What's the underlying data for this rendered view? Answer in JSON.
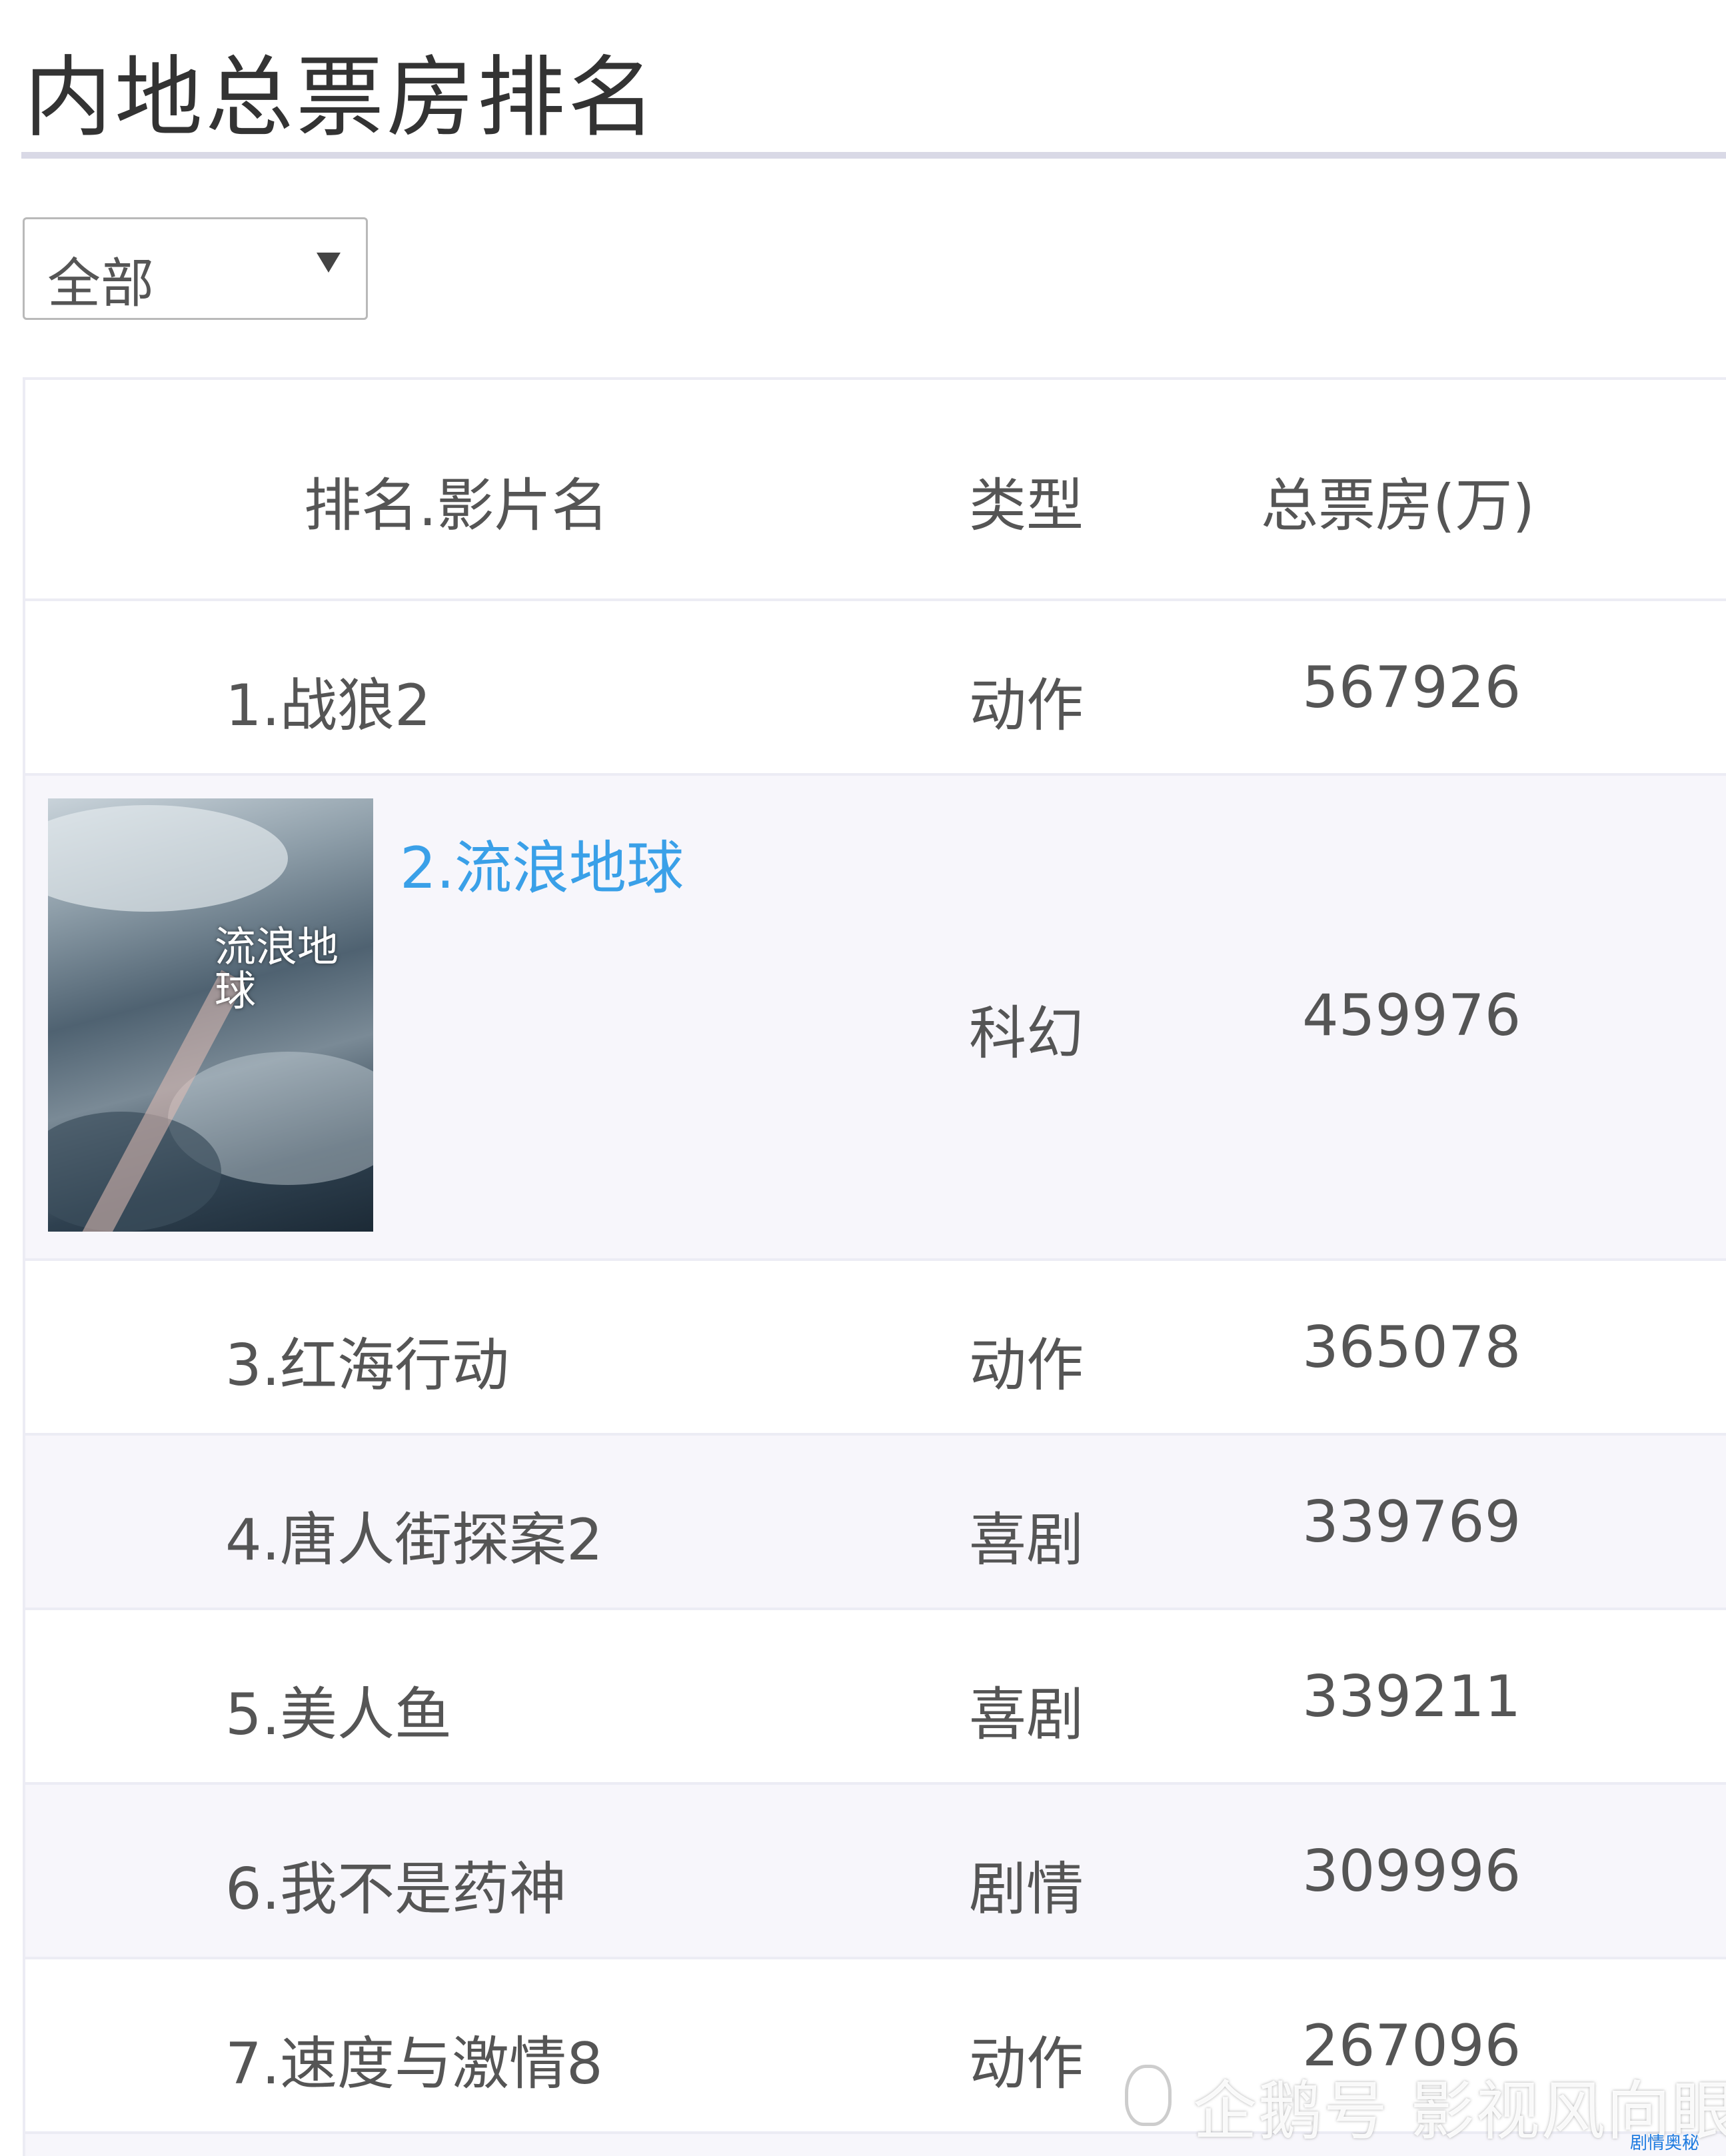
{
  "page": {
    "title": "内地总票房排名"
  },
  "filter": {
    "selected": "全部"
  },
  "table": {
    "headers": {
      "name": "排名.影片名",
      "genre": "类型",
      "box_office": "总票房(万)"
    },
    "rows": [
      {
        "name": "1.战狼2",
        "genre": "动作",
        "box_office": "567926"
      },
      {
        "name": "2.流浪地球",
        "genre": "科幻",
        "box_office": "459976"
      },
      {
        "name": "3.红海行动",
        "genre": "动作",
        "box_office": "365078"
      },
      {
        "name": "4.唐人街探案2",
        "genre": "喜剧",
        "box_office": "339769"
      },
      {
        "name": "5.美人鱼",
        "genre": "喜剧",
        "box_office": "339211"
      },
      {
        "name": "6.我不是药神",
        "genre": "剧情",
        "box_office": "309996"
      },
      {
        "name": "7.速度与激情8",
        "genre": "动作",
        "box_office": "267096"
      }
    ],
    "poster_text": "流浪地球"
  },
  "watermark": {
    "text": "企鹅号 影视风向眼",
    "badge": "剧情奥秘"
  },
  "colors": {
    "link": "#3aa0e8",
    "stripe": "#f7f6fb",
    "rule": "#d9d9e6"
  }
}
